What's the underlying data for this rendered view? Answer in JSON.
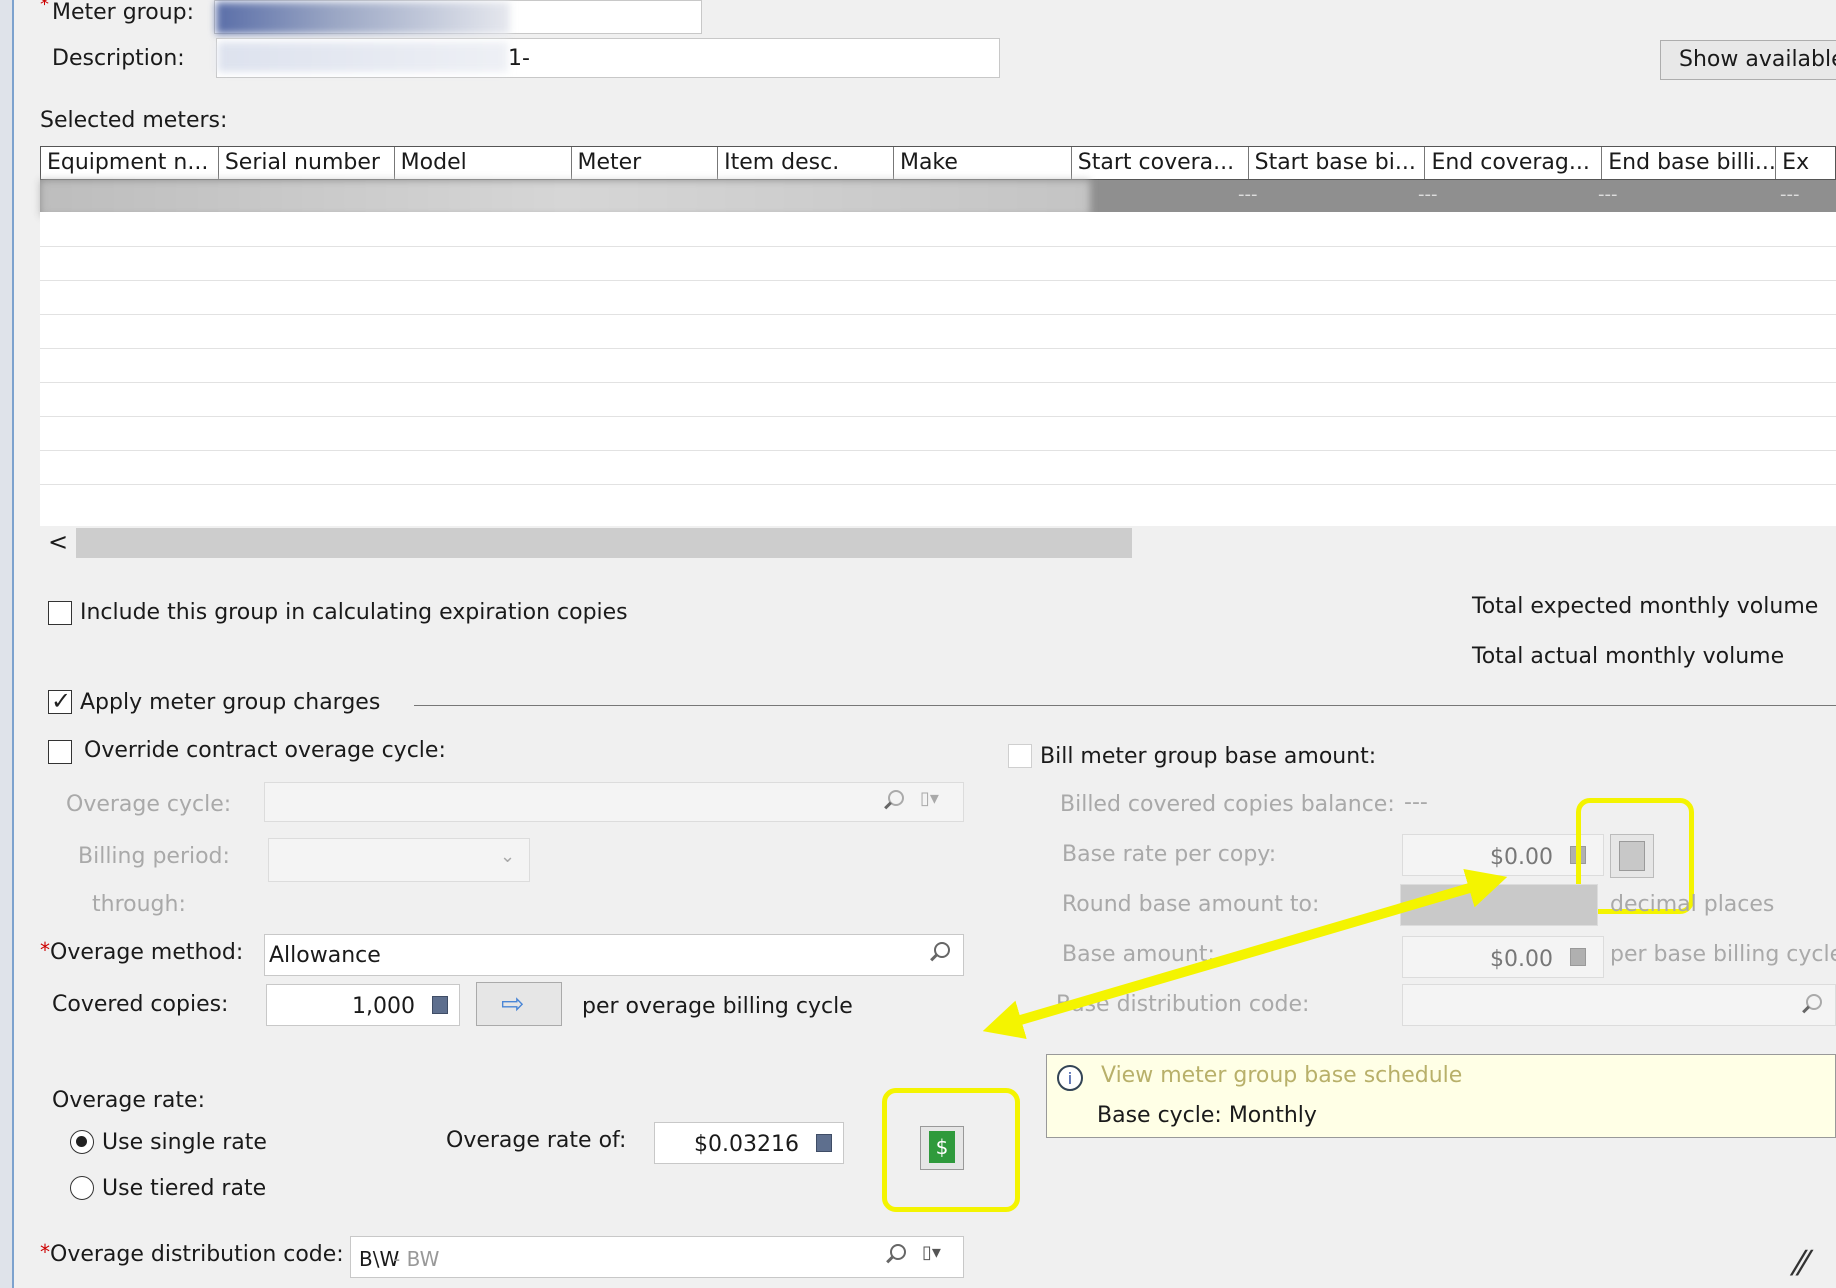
{
  "form": {
    "meter_group_label": "Meter group:",
    "description_label": "Description:",
    "description_value": "1-",
    "show_available_label": "Show available r",
    "selected_meters_label": "Selected meters:"
  },
  "grid": {
    "columns": [
      "Equipment n...",
      "Serial number",
      "Model",
      "Meter",
      "Item desc.",
      "Make",
      "Start covera...",
      "Start base bi...",
      "End coverag...",
      "End base billi...",
      "Ex"
    ],
    "row_dash": "---",
    "scroll_left": "<"
  },
  "options": {
    "include_expiration": "Include this group in calculating expiration copies",
    "apply_charges": "Apply meter group charges",
    "override_cycle": "Override contract overage cycle:"
  },
  "totals": {
    "expected": "Total expected monthly volume",
    "actual": "Total actual monthly volume"
  },
  "overage": {
    "cycle_label": "Overage cycle:",
    "billing_period_label": "Billing period:",
    "through_label": "through:",
    "method_label": "Overage method:",
    "method_value": "Allowance",
    "covered_copies_label": "Covered copies:",
    "covered_copies_value": "1,000",
    "per_cycle_text": "per overage billing cycle",
    "rate_label": "Overage rate:",
    "single_rate": "Use single rate",
    "tiered_rate": "Use tiered rate",
    "rate_of_label": "Overage rate of:",
    "rate_value": "$0.03216",
    "distribution_label": "Overage distribution code:",
    "distribution_code": "B\\W",
    "distribution_desc": " - BW"
  },
  "base": {
    "bill_label": "Bill meter group base amount:",
    "balance_label": "Billed covered copies balance:",
    "balance_value": "---",
    "rate_label": "Base rate per copy:",
    "rate_value": "$0.00",
    "round_label": "Round base amount to:",
    "round_suffix": "decimal places",
    "amount_label": "Base amount:",
    "amount_value": "$0.00",
    "amount_suffix": "per base billing cycle",
    "distribution_label": "Base distribution code:"
  },
  "info": {
    "link": "View meter group base schedule",
    "cycle": "Base cycle: Monthly"
  },
  "colors": {
    "highlight": "#f4f400",
    "link": "#b8b06a"
  }
}
